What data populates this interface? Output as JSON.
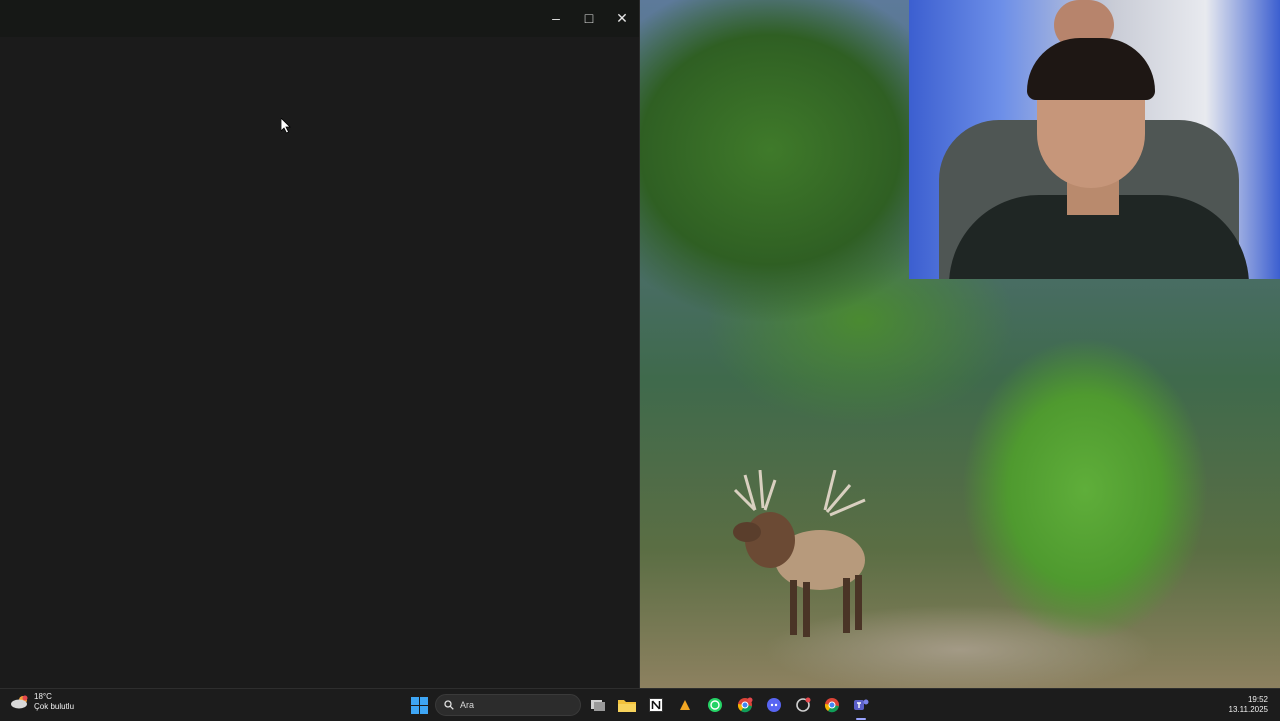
{
  "weather": {
    "temperature": "18°C",
    "description": "Çok bulutlu",
    "icon": "partly-cloudy-icon"
  },
  "search": {
    "label": "Ara"
  },
  "clock": {
    "time": "19:52",
    "date": "13.11.2025"
  },
  "window": {
    "controls": {
      "minimize": "–",
      "maximize": "□",
      "close": "✕"
    },
    "background": "#1b1b1b"
  },
  "taskbar": {
    "apps": [
      "windows-start",
      "task-view",
      "file-explorer",
      "notion",
      "app-yellow",
      "whatsapp",
      "chrome-profile",
      "discord",
      "app-circle",
      "chrome",
      "teams"
    ],
    "accent": "#1c1c1c"
  }
}
